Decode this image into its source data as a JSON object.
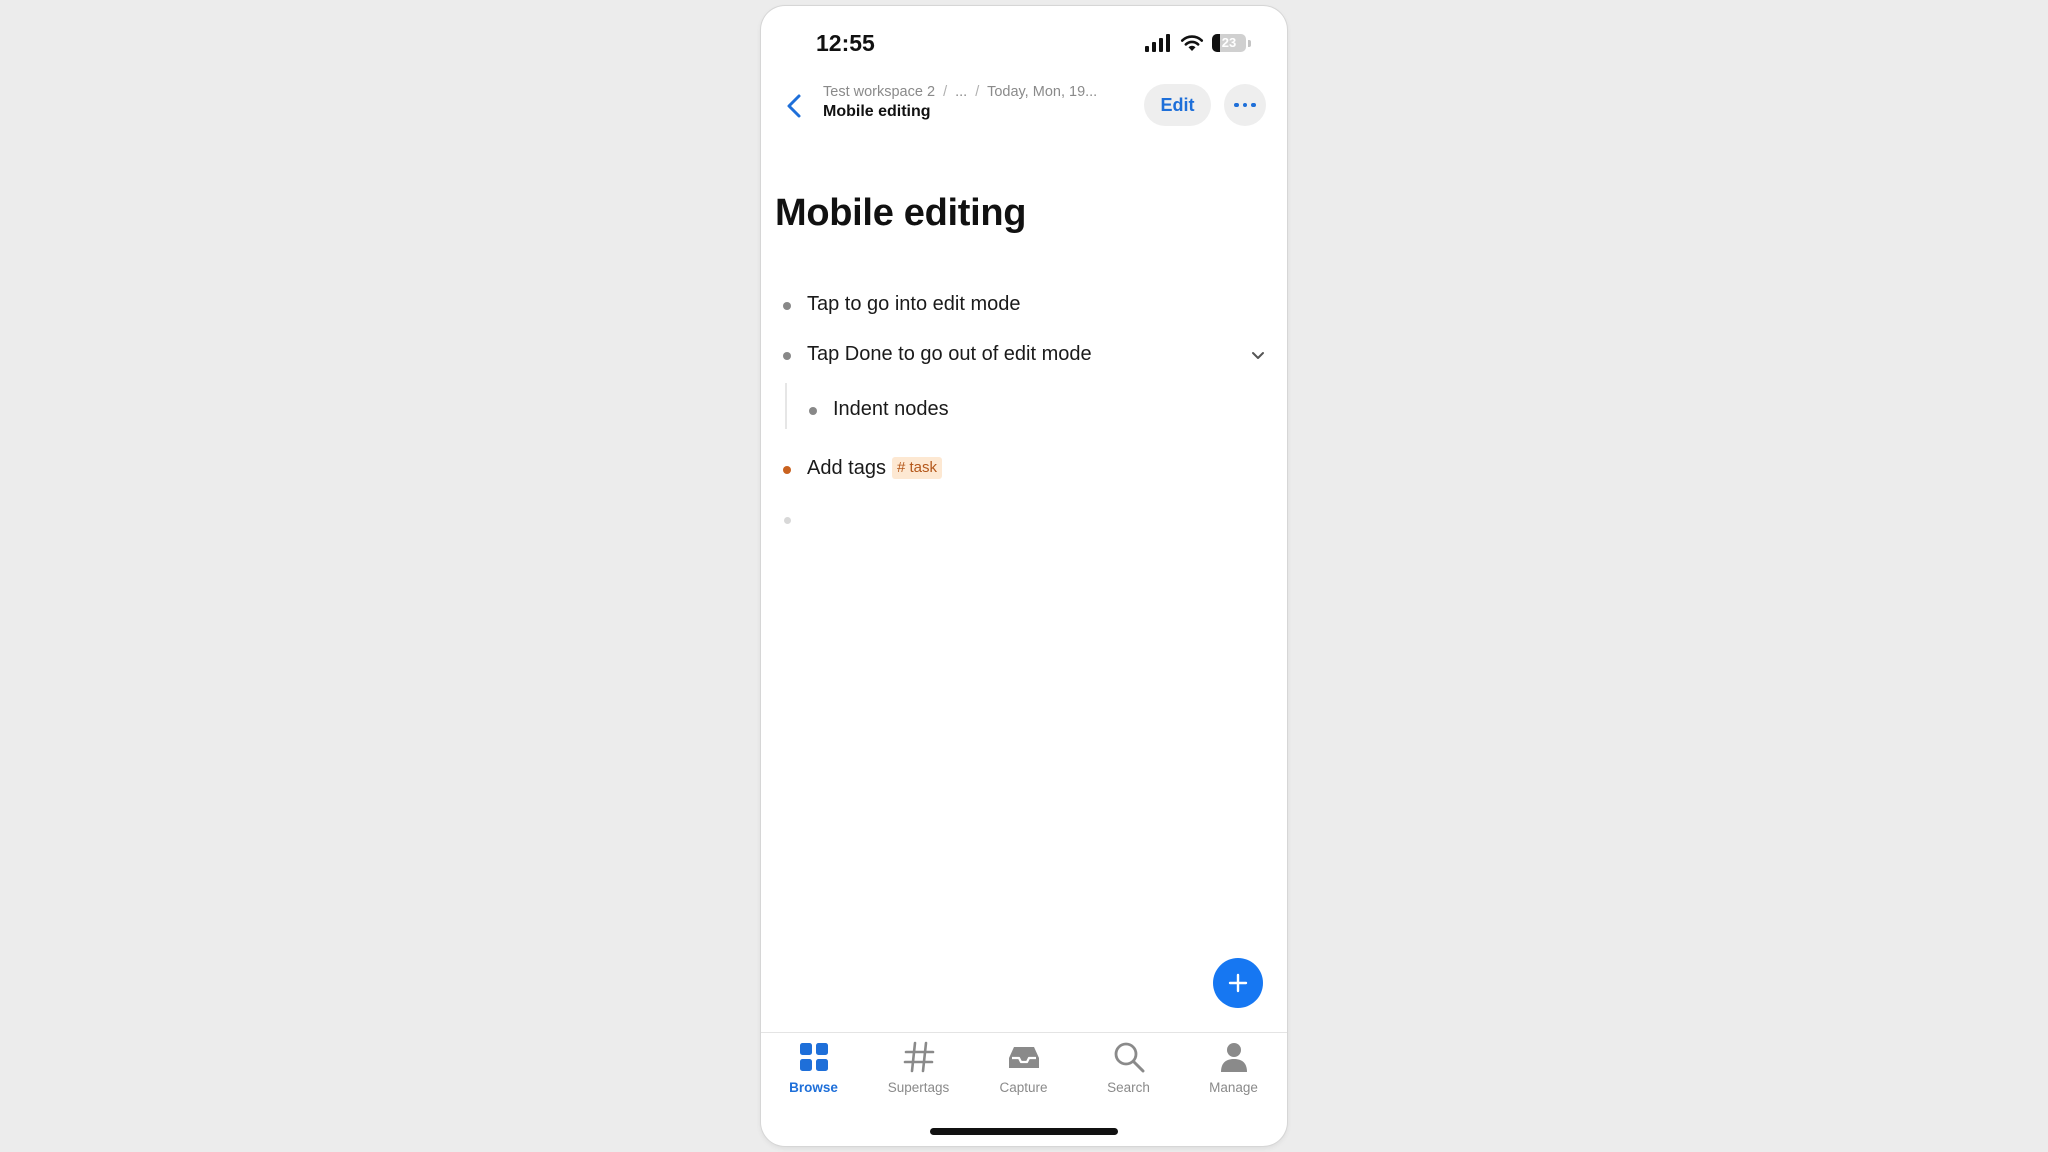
{
  "status_bar": {
    "time": "12:55",
    "battery_percent": "23",
    "icons": [
      "signal-icon",
      "wifi-icon",
      "battery-icon"
    ]
  },
  "header": {
    "breadcrumb": [
      "Test workspace 2",
      "...",
      "Today, Mon, 19..."
    ],
    "breadcrumb_separator": "/",
    "title": "Mobile editing",
    "edit_label": "Edit",
    "back_icon": "chevron-left-icon",
    "more_icon": "more-horizontal-icon"
  },
  "page": {
    "title": "Mobile editing",
    "nodes": [
      {
        "text": "Tap to go into edit mode"
      },
      {
        "text": "Tap Done to go out of edit mode",
        "expanded": true
      },
      {
        "text": "Indent nodes"
      },
      {
        "text": "Add tags",
        "tag": "# task"
      },
      {
        "text": ""
      }
    ]
  },
  "fab": {
    "icon": "plus-icon"
  },
  "tabbar": {
    "tabs": [
      {
        "label": "Browse",
        "icon": "grid-icon",
        "active": true
      },
      {
        "label": "Supertags",
        "icon": "hashtag-icon",
        "active": false
      },
      {
        "label": "Capture",
        "icon": "inbox-icon",
        "active": false
      },
      {
        "label": "Search",
        "icon": "search-icon",
        "active": false
      },
      {
        "label": "Manage",
        "icon": "person-icon",
        "active": false
      }
    ]
  },
  "colors": {
    "accent": "#1e6fd9",
    "fab": "#1677f2",
    "tag_bg": "#fde8d2",
    "tag_text": "#b4571a",
    "tagged_bullet": "#c9621f",
    "bullet": "#888888"
  }
}
